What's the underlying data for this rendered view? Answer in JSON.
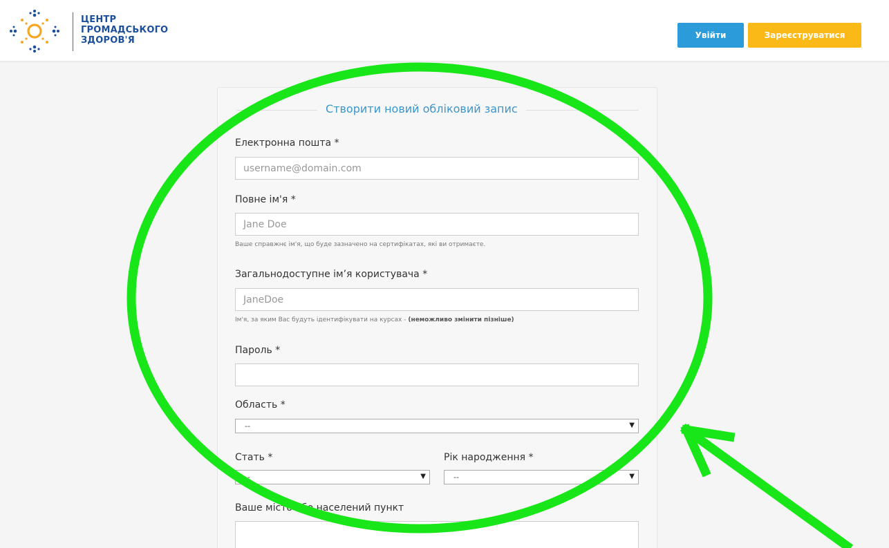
{
  "header": {
    "logo_lines": [
      "ЦЕНТР",
      "ГРОМАДСЬКОГО",
      "ЗДОРОВ'Я"
    ],
    "login_label": "Увійти",
    "register_label": "Зареєструватися",
    "colors": {
      "login": "#2b9bd9",
      "register": "#fbb917",
      "brand": "#1b4f9c"
    }
  },
  "form": {
    "title": "Створити новий обліковий запис",
    "email": {
      "label": "Електронна пошта *",
      "placeholder": "username@domain.com"
    },
    "fullname": {
      "label": "Повне ім'я *",
      "placeholder": "Jane Doe",
      "hint": "Ваше справжнє ім'я, що буде зазначено на сертифікатах, які ви отримаєте."
    },
    "username": {
      "label": "Загальнодоступне ім’я користувача *",
      "placeholder": "JaneDoe",
      "hint": "Ім'я, за яким Вас будуть ідентифікувати на курсах - ",
      "hint_bold": "(неможливо змінити пізніше)"
    },
    "password": {
      "label": "Пароль *",
      "value": ""
    },
    "region": {
      "label": "Область *",
      "selected": "--"
    },
    "gender": {
      "label": "Стать *",
      "selected": "--"
    },
    "birth_year": {
      "label": "Рік народження *",
      "selected": "--"
    },
    "city": {
      "label": "Ваше місто або населений пункт",
      "value": ""
    }
  },
  "annotation": {
    "color": "#19e619",
    "shapes": [
      "ellipse-highlight",
      "arrow-pointer"
    ]
  }
}
